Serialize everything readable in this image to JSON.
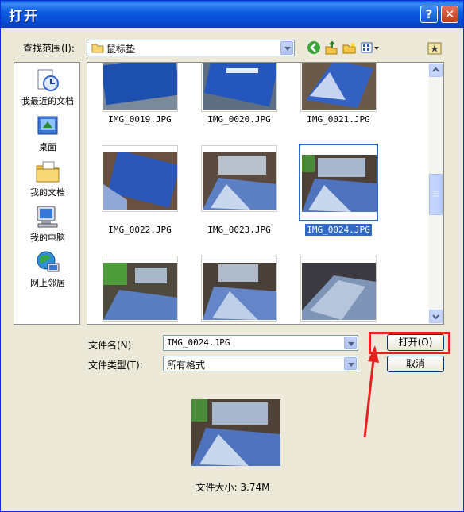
{
  "window": {
    "title": "打开",
    "help_label": "?",
    "close_label": "✕"
  },
  "look_in": {
    "label": "查找范围(I):",
    "value": "鼠标垫"
  },
  "toolbar": {
    "icons": [
      "back-icon",
      "up-folder-icon",
      "new-folder-icon",
      "view-menu-icon",
      "desktop-shortcut-icon"
    ]
  },
  "places": [
    {
      "label": "我最近的文档",
      "icon": "recent-documents-icon"
    },
    {
      "label": "桌面",
      "icon": "desktop-icon"
    },
    {
      "label": "我的文档",
      "icon": "my-documents-icon"
    },
    {
      "label": "我的电脑",
      "icon": "my-computer-icon"
    },
    {
      "label": "网上邻居",
      "icon": "network-places-icon"
    }
  ],
  "files": [
    {
      "name": "IMG_0019.JPG"
    },
    {
      "name": "IMG_0020.JPG"
    },
    {
      "name": "IMG_0021.JPG"
    },
    {
      "name": "IMG_0022.JPG"
    },
    {
      "name": "IMG_0023.JPG"
    },
    {
      "name": "IMG_0024.JPG",
      "selected": true
    },
    {
      "name": ""
    },
    {
      "name": ""
    },
    {
      "name": ""
    }
  ],
  "filename": {
    "label": "文件名(N):",
    "value": "IMG_0024.JPG"
  },
  "filetype": {
    "label": "文件类型(T):",
    "value": "所有格式"
  },
  "buttons": {
    "open": "打开(O)",
    "cancel": "取消"
  },
  "preview": {
    "size_text": "文件大小: 3.74M"
  },
  "colors": {
    "accent": "#316ac5",
    "highlight": "#e82020",
    "titlebar": "#0c5ee0"
  }
}
